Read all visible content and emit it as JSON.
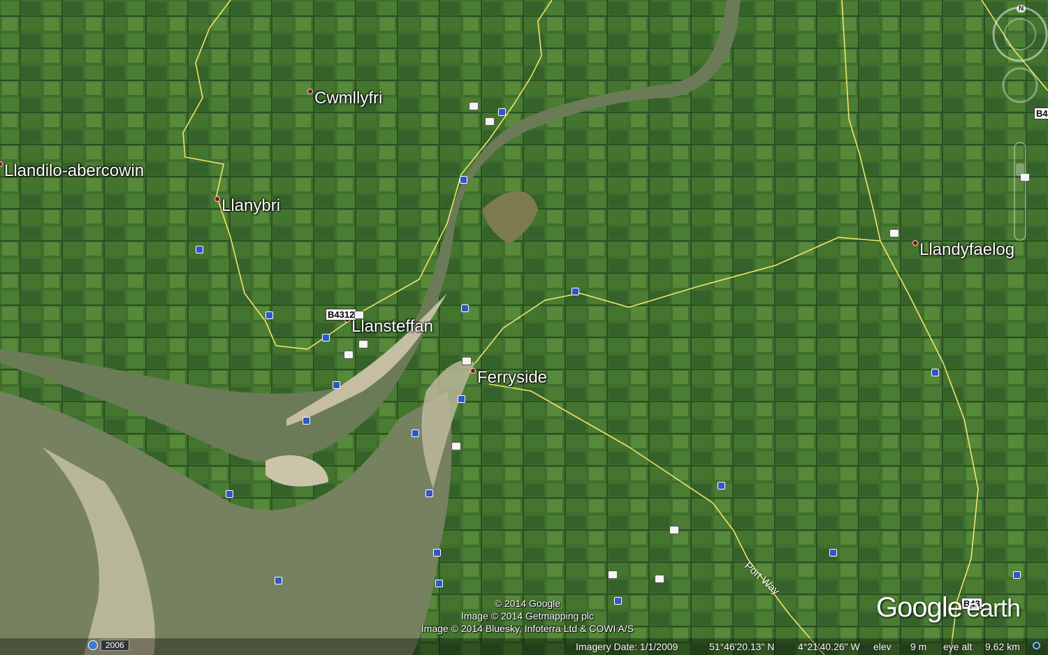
{
  "places": {
    "cwmllyfri": "Cwmllyfri",
    "llandilo": "Llandilo-abercowin",
    "llanybri": "Llanybri",
    "llansteffan": "Llansteffan",
    "ferryside": "Ferryside",
    "llandyfaelog": "Llandyfaelog"
  },
  "roads": {
    "shield_llansteffan": "B4312",
    "shield_east_edge": "B4",
    "shield_bottom": "B43",
    "road_name": "Port Way"
  },
  "credits": {
    "line1": "© 2014 Google",
    "line2": "Image © 2014 Getmapping plc",
    "line3": "Image © 2014 Bluesky, Infoterra Ltd & COWI A/S"
  },
  "history": {
    "year": "2006"
  },
  "statusbar": {
    "imagery_date": "Imagery Date: 1/1/2009",
    "latitude": "51°46'20.13\" N",
    "longitude": "4°21'40.26\" W",
    "elev_label": "elev",
    "elev_value": "9 m",
    "eye_alt_label": "eye alt",
    "eye_alt_value": "9.62 km"
  },
  "logo": {
    "google": "Google",
    "earth": "earth"
  },
  "compass": {
    "north_label": "N"
  },
  "colors": {
    "farmland": "#3f6e2d",
    "estuary": "#6b7a58",
    "sand": "#c8c2a8",
    "road": "#f1e56b",
    "place_pin": "#8a0f12"
  }
}
